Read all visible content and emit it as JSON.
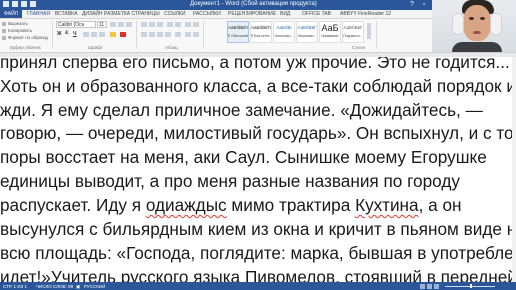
{
  "window": {
    "title": "Документ1 - Word (Сбой активации продукта)"
  },
  "tabs": [
    {
      "label": "ФАЙЛ"
    },
    {
      "label": "ГЛАВНАЯ"
    },
    {
      "label": "ВСТАВКА"
    },
    {
      "label": "ДИЗАЙН"
    },
    {
      "label": "РАЗМЕТКА СТРАНИЦЫ"
    },
    {
      "label": "ССЫЛКИ"
    },
    {
      "label": "РАССЫЛКИ"
    },
    {
      "label": "РЕЦЕНЗИРОВАНИЕ"
    },
    {
      "label": "ВИД"
    },
    {
      "label": "OFFICE TAB"
    },
    {
      "label": "ABBYY FineReader 12"
    }
  ],
  "ribbon": {
    "clipboard": {
      "paste": "Вставить",
      "cut": "Вырезать",
      "copy": "Копировать",
      "format_painter": "Формат по образцу",
      "group": "Буфер обмена"
    },
    "font": {
      "name": "Calibri (Осн",
      "size": "11",
      "group": "Шрифт"
    },
    "paragraph": {
      "group": "Абзац"
    },
    "styles": {
      "items": [
        {
          "sample": "АаБбВвГг",
          "name": "¶ Обычный"
        },
        {
          "sample": "АаБбВвГг",
          "name": "¶ Без инте..."
        },
        {
          "sample": "АаБбВі",
          "name": "Заголово..."
        },
        {
          "sample": "АаБбВвГ",
          "name": "Заголово..."
        },
        {
          "sample": "АаБ",
          "name": "Название"
        },
        {
          "sample": "АаБбВвГ",
          "name": "Подзагол..."
        }
      ],
      "group": "Стили"
    },
    "editing": {
      "find": "Найти",
      "replace": "Заменить",
      "select": "Выделить",
      "group": "Редактирование"
    }
  },
  "document": {
    "lines": [
      [
        {
          "t": "принял сперва его письмо, а потом уж прочие. Это не годится..."
        }
      ],
      [
        {
          "t": "Хоть он и образованного класса, а все-таки соблюдай порядок и"
        }
      ],
      [
        {
          "t": "жди. Я ему сделал приличное замечание. «Дожидайтесь, —"
        }
      ],
      [
        {
          "t": "говорю, — очереди, милостивый государь». Он вспыхнул, и с той"
        }
      ],
      [
        {
          "t": "поры восстает на меня, аки Саул. Сынишке моему Егорушке"
        }
      ],
      [
        {
          "t": "единицы выводит, а про меня разные названия по городу"
        }
      ],
      [
        {
          "t": "распускает. Иду я "
        },
        {
          "t": "одиаждыс",
          "err": true
        },
        {
          "t": " мимо трактира "
        },
        {
          "t": "Кухтина",
          "err": true
        },
        {
          "t": ", а он"
        }
      ],
      [
        {
          "t": "высунулся с бильярдным кием из окна и кричит в пьяном виде на"
        }
      ],
      [
        {
          "t": "всю площадь: «Господа, поглядите: марка, бывшая в употреблении,"
        }
      ],
      [
        {
          "t": "идет!»Учитель русского языка Пивомелов, стоявший в передней"
        }
      ]
    ]
  },
  "statusbar": {
    "page": "СТР. 1 ИЗ 1",
    "words": "ЧИСЛО СЛОВ: 89",
    "language": "РУССКИЙ"
  }
}
